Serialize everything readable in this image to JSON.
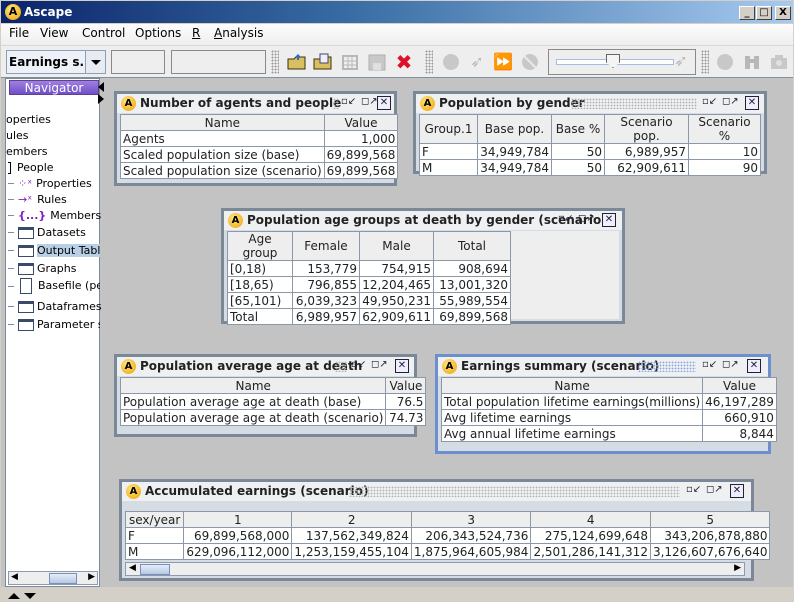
{
  "window": {
    "title": "Ascape",
    "app_icon": "A",
    "controls": [
      "_",
      "□",
      "X"
    ]
  },
  "menubar": [
    {
      "label": "File"
    },
    {
      "label": "View"
    },
    {
      "label": "Control"
    },
    {
      "label": "Options"
    },
    {
      "label": "R"
    },
    {
      "label": "Analysis"
    }
  ],
  "toolbar": {
    "scenario_combo": {
      "value": "Earnings s..."
    },
    "field1": "",
    "field2": "",
    "icons": [
      "open-folder-icon",
      "open-file-icon",
      "delete-table-icon",
      "save-icon",
      "close-red-x-icon",
      "restart-icon",
      "step-icon",
      "fast-forward-icon",
      "stop-icon",
      "speed-slider",
      "globe-icon",
      "binoculars-icon",
      "camera-icon"
    ],
    "speed_slider": {
      "value_fraction": 0.45
    }
  },
  "navigator": {
    "title": "Navigator",
    "items": [
      {
        "label": "operties",
        "icon": "none"
      },
      {
        "label": "ules",
        "icon": "none"
      },
      {
        "label": "embers",
        "icon": "none"
      },
      {
        "label": "People",
        "icon": "bracket-icon"
      },
      {
        "label": "Properties",
        "icon": "properties-icon"
      },
      {
        "label": "Rules",
        "icon": "rules-arrow-icon"
      },
      {
        "label": "Members",
        "icon": "members-braces-icon"
      },
      {
        "label": "Datasets",
        "icon": "folder-icon"
      },
      {
        "label": "Output Tables",
        "icon": "folder-icon",
        "selected": true
      },
      {
        "label": "Graphs",
        "icon": "folder-icon"
      },
      {
        "label": "Basefile (people)",
        "icon": "file-icon"
      },
      {
        "label": "Dataframes",
        "icon": "folder-icon"
      },
      {
        "label": "Parameter sets",
        "icon": "folder-icon"
      }
    ]
  },
  "frames": {
    "agents": {
      "title": "Number of agents and people",
      "columns": [
        "Name",
        "Value"
      ],
      "rows": [
        [
          "Agents",
          "1,000"
        ],
        [
          "Scaled population size (base)",
          "69,899,568"
        ],
        [
          "Scaled population size (scenario)",
          "69,899,568"
        ]
      ]
    },
    "gender": {
      "title": "Population by gender",
      "columns": [
        "Group.1",
        "Base pop.",
        "Base %",
        "Scenario pop.",
        "Scenario %"
      ],
      "rows": [
        [
          "F",
          "34,949,784",
          "50",
          "6,989,957",
          "10"
        ],
        [
          "M",
          "34,949,784",
          "50",
          "62,909,611",
          "90"
        ]
      ]
    },
    "agegroups": {
      "title": "Population age groups at death by gender (scenario)",
      "columns": [
        "Age group",
        "Female",
        "Male",
        "Total"
      ],
      "rows": [
        [
          "[0,18)",
          "153,779",
          "754,915",
          "908,694"
        ],
        [
          "[18,65)",
          "796,855",
          "12,204,465",
          "13,001,320"
        ],
        [
          "[65,101)",
          "6,039,323",
          "49,950,231",
          "55,989,554"
        ],
        [
          "Total",
          "6,989,957",
          "62,909,611",
          "69,899,568"
        ]
      ]
    },
    "avgage": {
      "title": "Population average age at death",
      "columns": [
        "Name",
        "Value"
      ],
      "rows": [
        [
          "Population average age at death (base)",
          "76.5"
        ],
        [
          "Population average age at death (scenario)",
          "74.73"
        ]
      ]
    },
    "earnings": {
      "title": "Earnings summary (scenario)",
      "columns": [
        "Name",
        "Value"
      ],
      "rows": [
        [
          "Total population lifetime earnings(millions)",
          "46,197,289"
        ],
        [
          "Avg lifetime earnings",
          "660,910"
        ],
        [
          "Avg annual lifetime earnings",
          "8,844"
        ]
      ]
    },
    "accumulated": {
      "title": "Accumulated earnings (scenario)",
      "columns": [
        "sex/year",
        "1",
        "2",
        "3",
        "4",
        "5"
      ],
      "rows": [
        [
          "F",
          "69,899,568,000",
          "137,562,349,824",
          "206,343,524,736",
          "275,124,699,648",
          "343,206,878,880"
        ],
        [
          "M",
          "629,096,112,000",
          "1,253,159,455,104",
          "1,875,964,605,984",
          "2,501,286,141,312",
          "3,126,607,676,640"
        ]
      ]
    }
  },
  "colors": {
    "titlebar_start": "#0a246a",
    "titlebar_end": "#a6caf0",
    "desktop": "#c3c3c3",
    "active_frame": "#6e8fcf",
    "navigator_title": "#7050c8",
    "close_x_red": "#e0102a"
  }
}
